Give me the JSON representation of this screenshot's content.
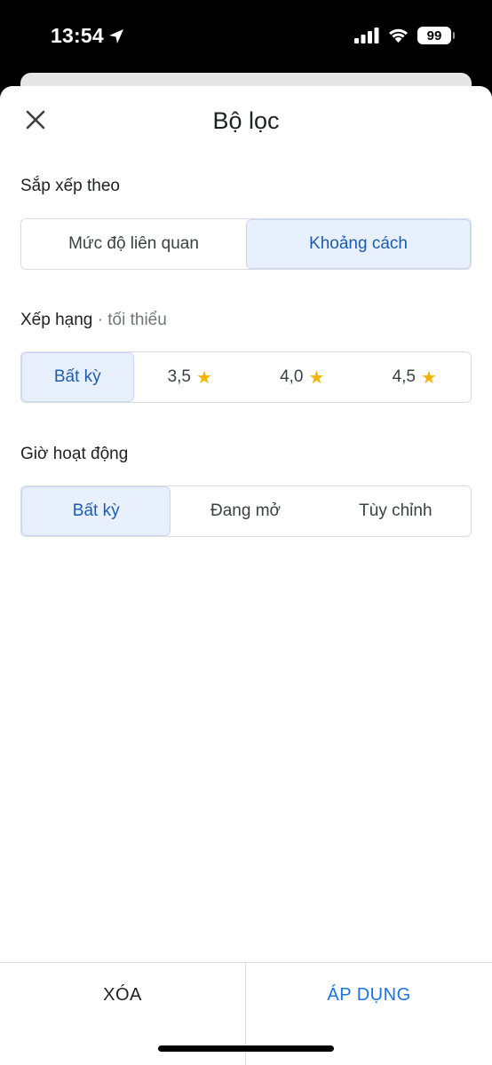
{
  "status_bar": {
    "time": "13:54",
    "battery": "99"
  },
  "header": {
    "title": "Bộ lọc"
  },
  "sort": {
    "label": "Sắp xếp theo",
    "options": [
      "Mức độ liên quan",
      "Khoảng cách"
    ],
    "selected": "Khoảng cách"
  },
  "rating": {
    "label": "Xếp hạng",
    "sublabel": "· tối thiểu",
    "options": [
      "Bất kỳ",
      "3,5",
      "4,0",
      "4,5"
    ],
    "selected": "Bất kỳ"
  },
  "hours": {
    "label": "Giờ hoạt động",
    "options": [
      "Bất kỳ",
      "Đang mở",
      "Tùy chỉnh"
    ],
    "selected": "Bất kỳ"
  },
  "footer": {
    "clear_label": "XÓA",
    "apply_label": "ÁP DỤNG"
  },
  "colors": {
    "accent": "#1a73e8",
    "selected_bg": "#e8f0fe",
    "star": "#f4b400"
  }
}
